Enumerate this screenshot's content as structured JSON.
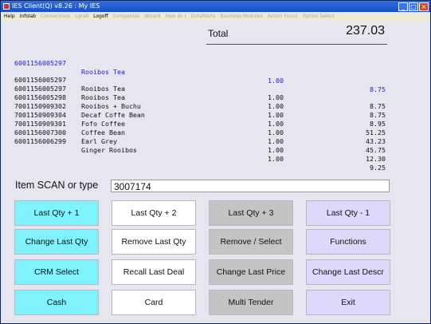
{
  "window": {
    "title": "IES Client(Q) v8.26 : My IES"
  },
  "menu": {
    "items": [
      {
        "label": "Help",
        "enabled": true
      },
      {
        "label": "Infolab",
        "enabled": true
      },
      {
        "label": "Connections",
        "enabled": false
      },
      {
        "label": "Lgrab",
        "enabled": false
      },
      {
        "label": "Logoff",
        "enabled": true
      },
      {
        "label": "Companies",
        "enabled": false
      },
      {
        "label": "Wizard",
        "enabled": false
      },
      {
        "label": "How do I",
        "enabled": false
      },
      {
        "label": "DataMarts",
        "enabled": false
      },
      {
        "label": "Business Modules",
        "enabled": false
      },
      {
        "label": "Action Focus",
        "enabled": false
      },
      {
        "label": "Option Select",
        "enabled": false
      }
    ]
  },
  "total": {
    "label": "Total",
    "value": "237.03"
  },
  "last_item": {
    "code": "6001156005297",
    "desc": "Rooibos Tea",
    "qty": "1.00",
    "amount": "8.75"
  },
  "items": [
    {
      "code": "6001156005297",
      "desc": "Rooibos Tea",
      "qty": "1.00",
      "amount": "8.75"
    },
    {
      "code": "6001156005297",
      "desc": "Rooibos Tea",
      "qty": "1.00",
      "amount": "8.75"
    },
    {
      "code": "6001156005298",
      "desc": "Rooibos + Buchu",
      "qty": "1.00",
      "amount": "8.95"
    },
    {
      "code": "7001150909302",
      "desc": "Decaf Coffe Bean",
      "qty": "1.00",
      "amount": "51.25"
    },
    {
      "code": "7001150909304",
      "desc": "Fofo Coffee",
      "qty": "1.00",
      "amount": "43.23"
    },
    {
      "code": "7001150909301",
      "desc": "Coffee Bean",
      "qty": "1.00",
      "amount": "45.75"
    },
    {
      "code": "6001156007300",
      "desc": "Earl Grey",
      "qty": "1.00",
      "amount": "12.30"
    },
    {
      "code": "6001156006299",
      "desc": "Ginger Rooibos",
      "qty": "1.00",
      "amount": "9.25"
    }
  ],
  "scan": {
    "label": "Item SCAN or type",
    "value": "3007174"
  },
  "buttons": {
    "last_qty_plus_1": "Last Qty + 1",
    "last_qty_plus_2": "Last Qty + 2",
    "last_qty_plus_3": "Last Qty + 3",
    "last_qty_minus_1": "Last Qty - 1",
    "change_last_qty": "Change Last Qty",
    "remove_last_qty": "Remove Last Qty",
    "remove_select": "Remove / Select",
    "functions": "Functions",
    "crm_select": "CRM Select",
    "recall_last_deal": "Recall Last Deal",
    "change_last_price": "Change Last Price",
    "change_last_descr": "Change Last Descr",
    "cash": "Cash",
    "card": "Card",
    "multi_tender": "Multi Tender",
    "exit": "Exit"
  },
  "colors": {
    "cyan": "#7ff2fb",
    "white": "#ffffff",
    "gray": "#c4c4c4",
    "lavender": "#ddd9fb",
    "last_item": "#1c1ccf"
  }
}
